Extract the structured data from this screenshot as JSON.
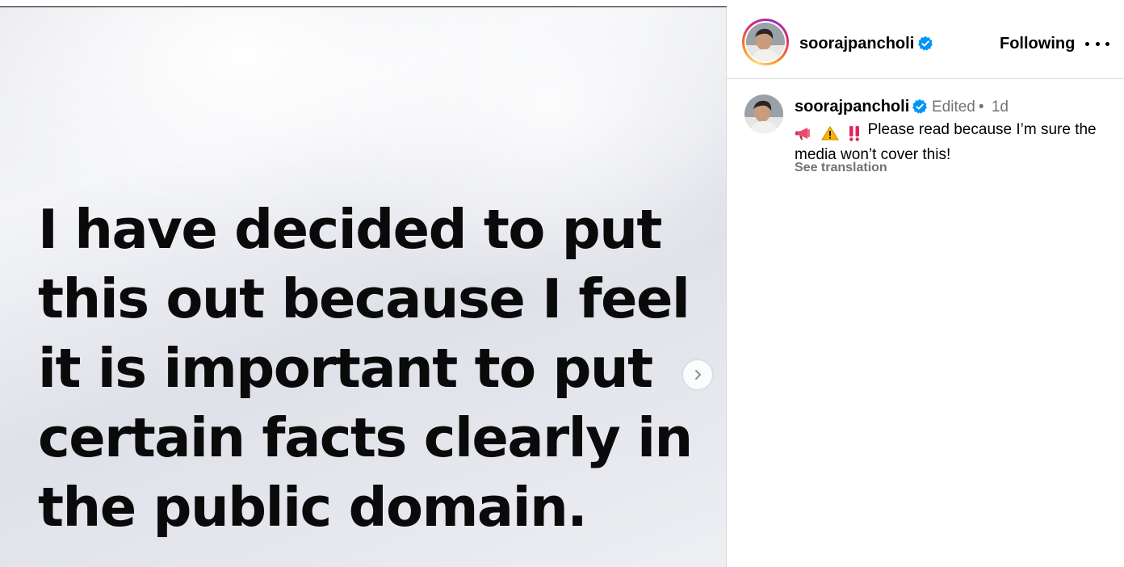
{
  "post": {
    "image_text": "I have decided to put this out because I feel it is important to put certain facts clearly in the public domain."
  },
  "header": {
    "username": "soorajpancholi",
    "follow_state": "Following",
    "more_icon": "more-horizontal-icon"
  },
  "caption": {
    "username": "soorajpancholi",
    "edited": "Edited",
    "separator": "•",
    "time": "1d",
    "emojis": [
      "megaphone",
      "warning",
      "double-exclamation"
    ],
    "text": "Please read because I’m sure the media won’t cover this!",
    "see_translation": "See translation"
  },
  "colors": {
    "verified": "#0095f6",
    "muted": "#737373",
    "divider": "#dbdbdb"
  }
}
